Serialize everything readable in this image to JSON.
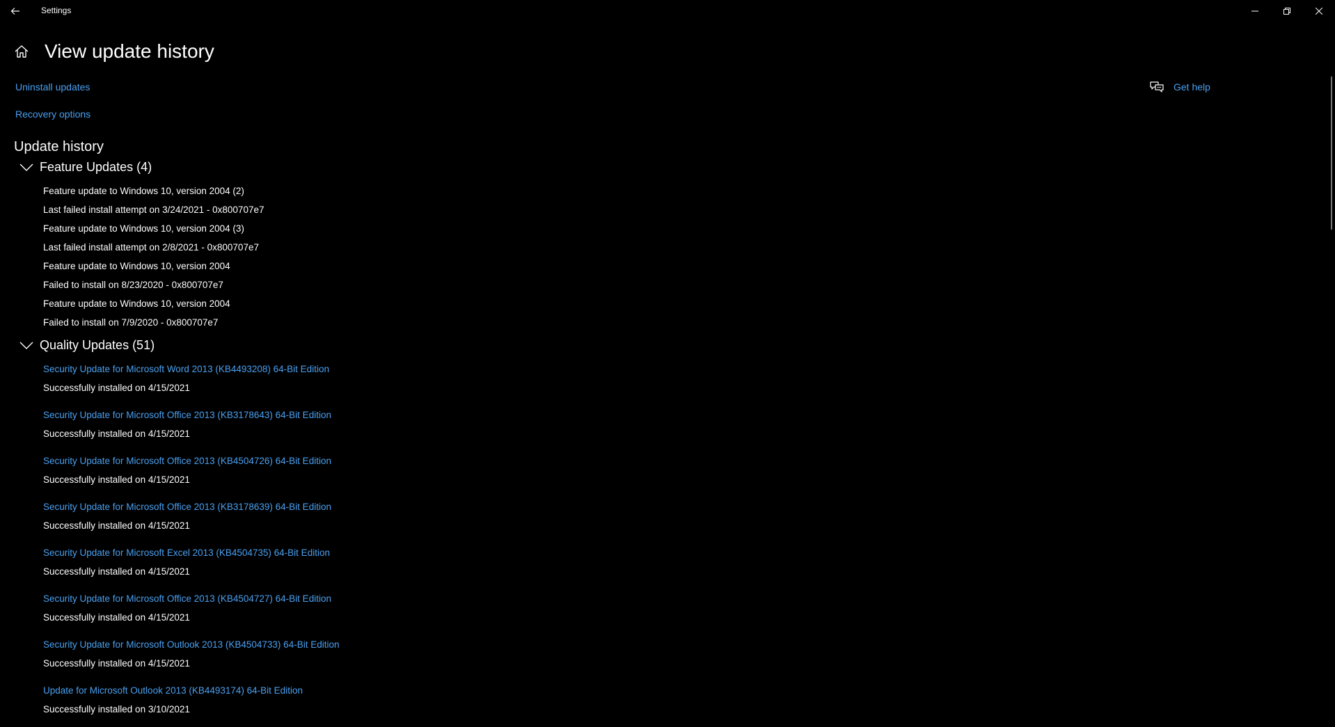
{
  "window": {
    "title": "Settings"
  },
  "page": {
    "title": "View update history"
  },
  "links": {
    "uninstall": "Uninstall updates",
    "recovery": "Recovery options",
    "help": "Get help"
  },
  "section": {
    "title": "Update history"
  },
  "feature_group": {
    "title": "Feature Updates (4)",
    "items": [
      {
        "name": "Feature update to Windows 10, version 2004 (2)",
        "status": "Last failed install attempt on 3/24/2021 - 0x800707e7"
      },
      {
        "name": "Feature update to Windows 10, version 2004 (3)",
        "status": "Last failed install attempt on 2/8/2021 - 0x800707e7"
      },
      {
        "name": "Feature update to Windows 10, version 2004",
        "status": "Failed to install on 8/23/2020 - 0x800707e7"
      },
      {
        "name": "Feature update to Windows 10, version 2004",
        "status": "Failed to install on 7/9/2020 - 0x800707e7"
      }
    ]
  },
  "quality_group": {
    "title": "Quality Updates (51)",
    "items": [
      {
        "name": "Security Update for Microsoft Word 2013 (KB4493208) 64-Bit Edition",
        "status": "Successfully installed on 4/15/2021"
      },
      {
        "name": "Security Update for Microsoft Office 2013 (KB3178643) 64-Bit Edition",
        "status": "Successfully installed on 4/15/2021"
      },
      {
        "name": "Security Update for Microsoft Office 2013 (KB4504726) 64-Bit Edition",
        "status": "Successfully installed on 4/15/2021"
      },
      {
        "name": "Security Update for Microsoft Office 2013 (KB3178639) 64-Bit Edition",
        "status": "Successfully installed on 4/15/2021"
      },
      {
        "name": "Security Update for Microsoft Excel 2013 (KB4504735) 64-Bit Edition",
        "status": "Successfully installed on 4/15/2021"
      },
      {
        "name": "Security Update for Microsoft Office 2013 (KB4504727) 64-Bit Edition",
        "status": "Successfully installed on 4/15/2021"
      },
      {
        "name": "Security Update for Microsoft Outlook 2013 (KB4504733) 64-Bit Edition",
        "status": "Successfully installed on 4/15/2021"
      },
      {
        "name": "Update for Microsoft Outlook 2013 (KB4493174) 64-Bit Edition",
        "status": "Successfully installed on 3/10/2021"
      }
    ]
  },
  "icons": {
    "back": "back-arrow-icon",
    "home": "home-icon",
    "help": "chat-help-icon",
    "chevron": "chevron-down-icon",
    "minimize": "minimize-icon",
    "restore": "restore-icon",
    "close": "close-icon"
  },
  "colors": {
    "background": "#000000",
    "text": "#ffffff",
    "link": "#4aa0f0"
  }
}
